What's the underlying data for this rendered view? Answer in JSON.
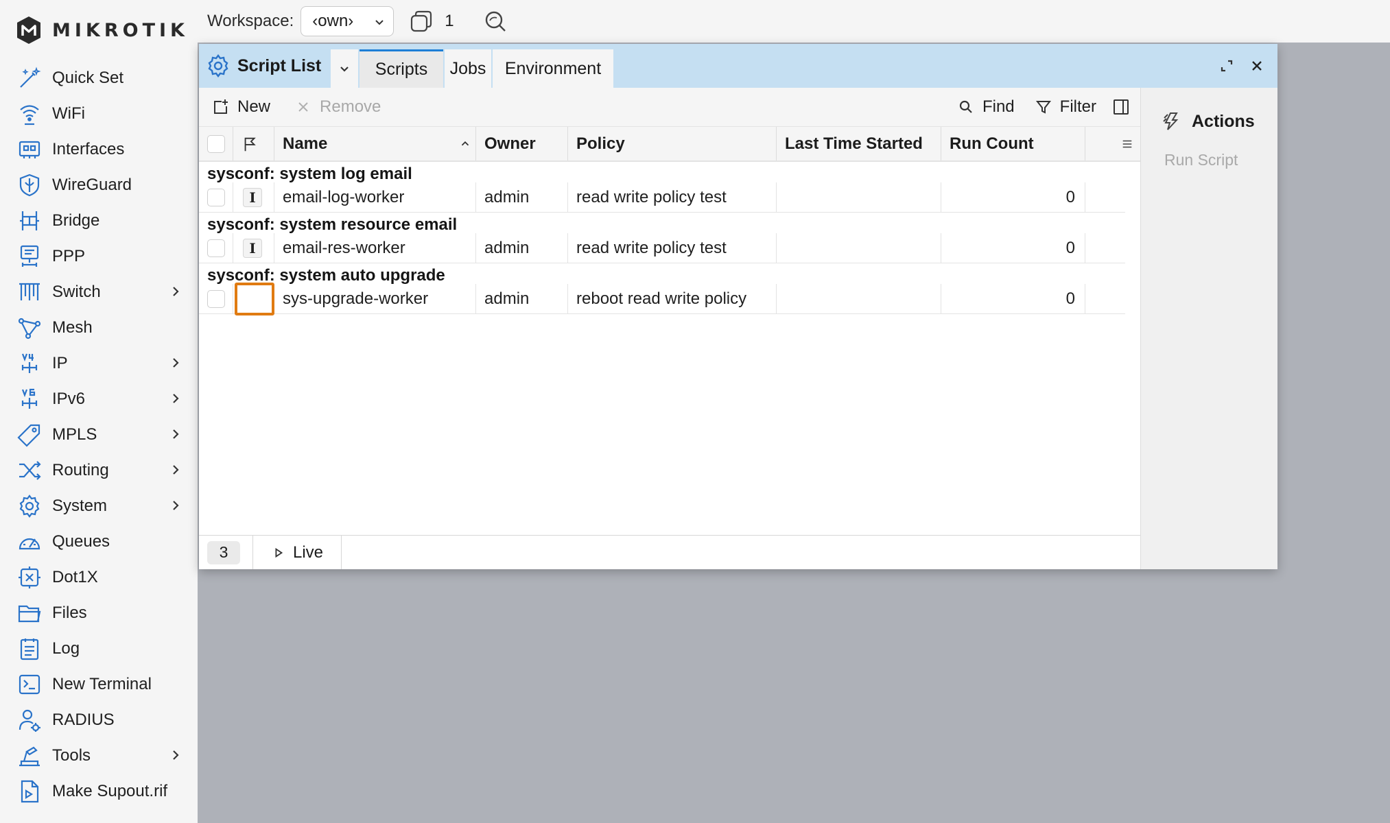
{
  "brand": {
    "logo_text": "MIKROTIK"
  },
  "sidebar": {
    "items": [
      {
        "label": "Quick Set",
        "icon": "wand-icon",
        "submenu": false
      },
      {
        "label": "WiFi",
        "icon": "wifi-icon",
        "submenu": false
      },
      {
        "label": "Interfaces",
        "icon": "interfaces-icon",
        "submenu": false
      },
      {
        "label": "WireGuard",
        "icon": "wireguard-shield-icon",
        "submenu": false
      },
      {
        "label": "Bridge",
        "icon": "bridge-icon",
        "submenu": false
      },
      {
        "label": "PPP",
        "icon": "ppp-icon",
        "submenu": false
      },
      {
        "label": "Switch",
        "icon": "switch-icon",
        "submenu": true
      },
      {
        "label": "Mesh",
        "icon": "mesh-icon",
        "submenu": false
      },
      {
        "label": "IP",
        "icon": "ipv4-icon",
        "submenu": true
      },
      {
        "label": "IPv6",
        "icon": "ipv6-icon",
        "submenu": true
      },
      {
        "label": "MPLS",
        "icon": "tag-icon",
        "submenu": true
      },
      {
        "label": "Routing",
        "icon": "routing-icon",
        "submenu": true
      },
      {
        "label": "System",
        "icon": "gear-icon",
        "submenu": true
      },
      {
        "label": "Queues",
        "icon": "gauge-icon",
        "submenu": false
      },
      {
        "label": "Dot1X",
        "icon": "dot1x-icon",
        "submenu": false
      },
      {
        "label": "Files",
        "icon": "folder-icon",
        "submenu": false
      },
      {
        "label": "Log",
        "icon": "log-icon",
        "submenu": false
      },
      {
        "label": "New Terminal",
        "icon": "terminal-icon",
        "submenu": false
      },
      {
        "label": "RADIUS",
        "icon": "radius-icon",
        "submenu": false
      },
      {
        "label": "Tools",
        "icon": "tools-icon",
        "submenu": true
      },
      {
        "label": "Make Supout.rif",
        "icon": "supout-file-icon",
        "submenu": false
      }
    ]
  },
  "topbar": {
    "workspace_label": "Workspace:",
    "workspace_value": "‹own›",
    "window_count": "1"
  },
  "window": {
    "title": "Script List",
    "tabs": [
      {
        "label": "Scripts",
        "active": true
      },
      {
        "label": "Jobs",
        "active": false
      },
      {
        "label": "Environment",
        "active": false
      }
    ]
  },
  "toolbar": {
    "new_label": "New",
    "remove_label": "Remove",
    "find_label": "Find",
    "filter_label": "Filter"
  },
  "table": {
    "columns": [
      "Name",
      "Owner",
      "Policy",
      "Last Time Started",
      "Run Count"
    ],
    "groups": [
      {
        "title": "sysconf: system log email",
        "rows": [
          {
            "flag": "I",
            "name": "email-log-worker",
            "owner": "admin",
            "policy": "read write policy test",
            "last_started": "",
            "run_count": "0"
          }
        ]
      },
      {
        "title": "sysconf: system resource email",
        "rows": [
          {
            "flag": "I",
            "name": "email-res-worker",
            "owner": "admin",
            "policy": "read write policy test",
            "last_started": "",
            "run_count": "0"
          }
        ]
      },
      {
        "title": "sysconf: system auto upgrade",
        "rows": [
          {
            "flag": "",
            "name": "sys-upgrade-worker",
            "owner": "admin",
            "policy": "reboot read write policy",
            "last_started": "",
            "run_count": "0"
          }
        ]
      }
    ]
  },
  "status": {
    "count": "3",
    "live_label": "Live"
  },
  "actions": {
    "title": "Actions",
    "run_script_label": "Run Script"
  },
  "colors": {
    "accent": "#1d7fd6",
    "header_bg": "#c5dff2",
    "highlight": "#e07b12"
  }
}
